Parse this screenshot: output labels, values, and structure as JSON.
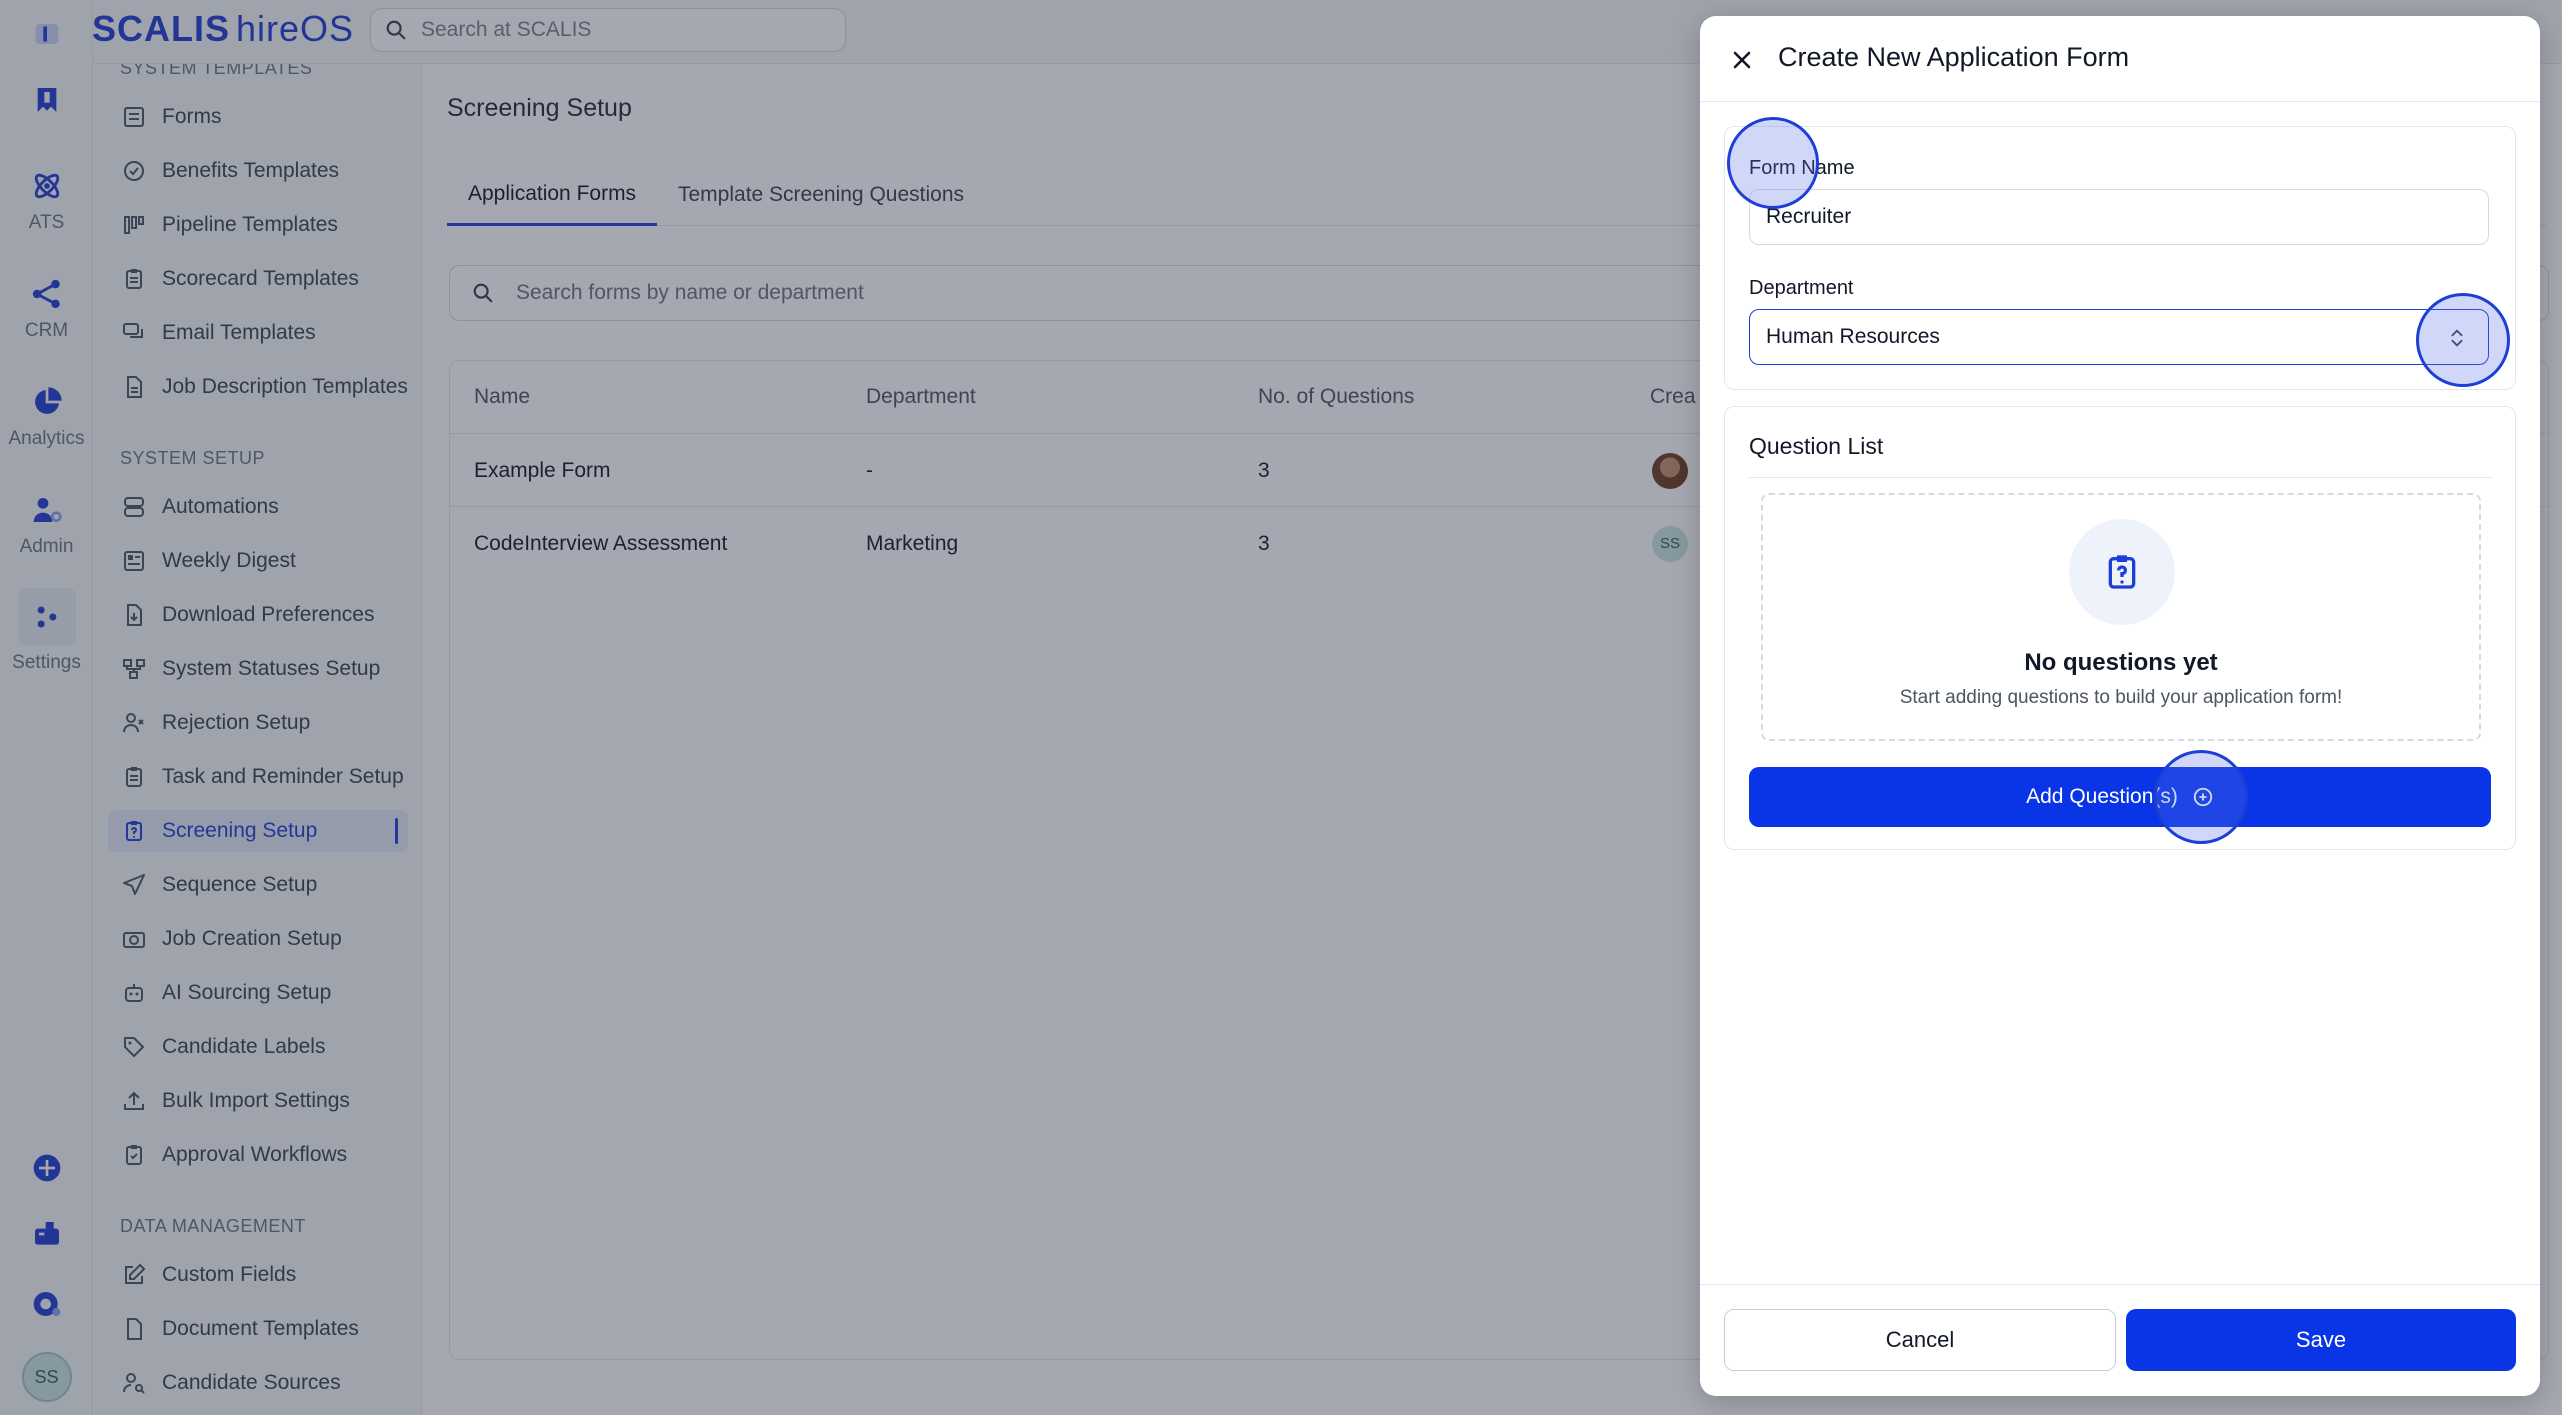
{
  "app": {
    "brand": "SCALIS",
    "product": "hireOS",
    "search_placeholder": "Search at SCALIS"
  },
  "rail": {
    "items": [
      {
        "label": ""
      },
      {
        "label": "ATS"
      },
      {
        "label": "CRM"
      },
      {
        "label": "Analytics"
      },
      {
        "label": "Admin"
      },
      {
        "label": "Settings"
      }
    ],
    "user_initials": "SS"
  },
  "sidebar": {
    "system_templates_title": "SYSTEM TEMPLATES",
    "system_templates": [
      "Forms",
      "Benefits Templates",
      "Pipeline Templates",
      "Scorecard Templates",
      "Email Templates",
      "Job Description Templates"
    ],
    "system_setup_title": "SYSTEM SETUP",
    "system_setup": [
      "Automations",
      "Weekly Digest",
      "Download Preferences",
      "System Statuses Setup",
      "Rejection Setup",
      "Task and Reminder Setup",
      "Screening Setup",
      "Sequence Setup",
      "Job Creation Setup",
      "AI Sourcing Setup",
      "Candidate Labels",
      "Bulk Import Settings",
      "Approval Workflows"
    ],
    "data_management_title": "DATA MANAGEMENT",
    "data_management": [
      "Custom Fields",
      "Document Templates",
      "Candidate Sources"
    ],
    "active_item": "Screening Setup"
  },
  "main": {
    "title": "Screening Setup",
    "tabs": [
      "Application Forms",
      "Template Screening Questions"
    ],
    "active_tab": "Application Forms",
    "search_placeholder": "Search forms by name or department",
    "columns": [
      "Name",
      "Department",
      "No. of Questions",
      "Crea"
    ],
    "rows": [
      {
        "name": "Example Form",
        "department": "-",
        "questions": "3",
        "creator": ""
      },
      {
        "name": "CodeInterview Assessment",
        "department": "Marketing",
        "questions": "3",
        "creator": "SS"
      }
    ]
  },
  "modal": {
    "title": "Create New Application Form",
    "form_name_label": "Form Name",
    "form_name_value": "Recruiter",
    "department_label": "Department",
    "department_value": "Human Resources",
    "question_list_title": "Question List",
    "empty_title": "No questions yet",
    "empty_subtitle": "Start adding questions to build your application form!",
    "add_button": "Add Question(s)",
    "cancel": "Cancel",
    "save": "Save"
  },
  "colors": {
    "primary": "#0a35e6",
    "brand": "#1f3bd1",
    "overlay": "rgba(40,48,66,0.42)"
  }
}
